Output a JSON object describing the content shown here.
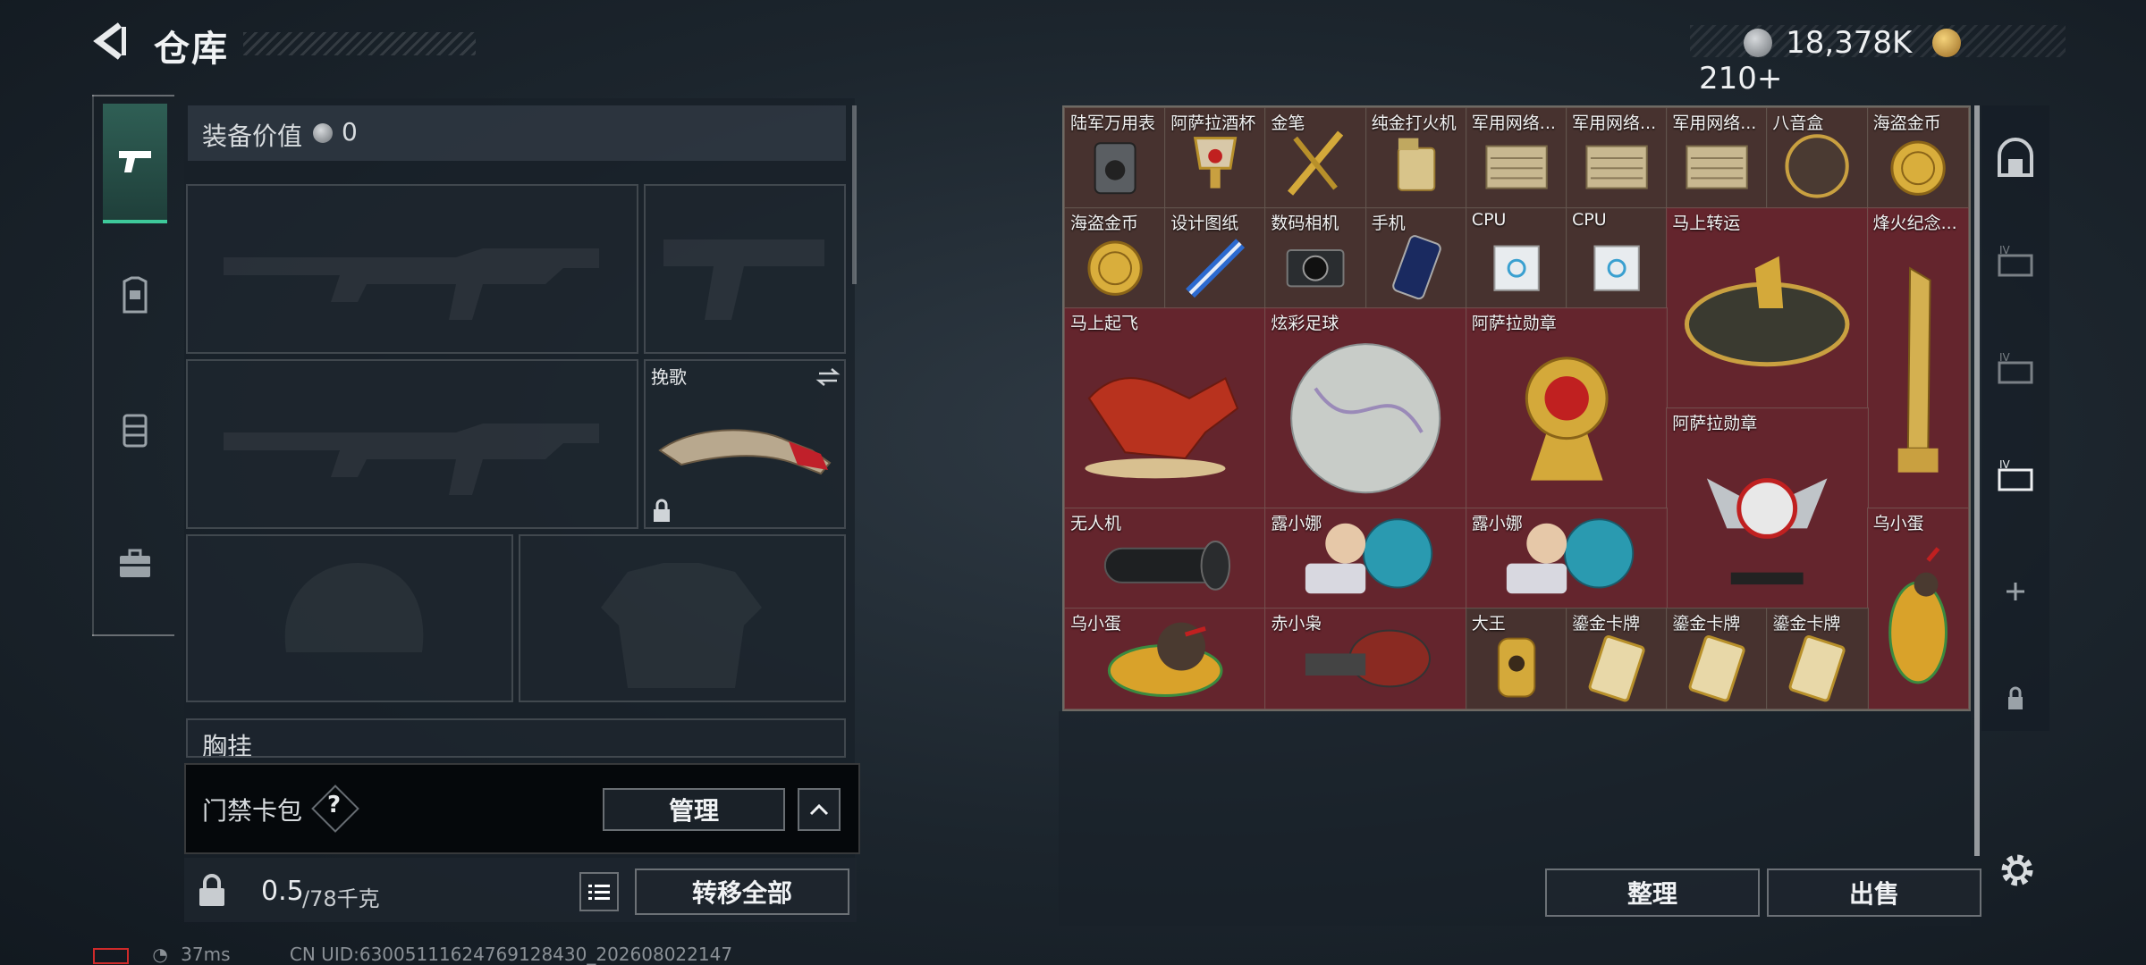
{
  "header": {
    "title": "仓库"
  },
  "currency": {
    "coins": "18,378K",
    "tokens": "210+"
  },
  "left": {
    "value_label": "装备价值",
    "value": "0",
    "melee_name": "挽歌",
    "chest_label": "胸挂",
    "keycard_label": "门禁卡包",
    "keycard_help": "?",
    "manage_label": "管理",
    "weight_value": "0.5",
    "weight_max": "/78千克",
    "transfer_all_label": "转移全部"
  },
  "grid": {
    "items": [
      {
        "name": "陆军万用表",
        "icon": "multimeter-icon"
      },
      {
        "name": "阿萨拉酒杯",
        "icon": "goblet-icon"
      },
      {
        "name": "金笔",
        "icon": "gold-pen-icon"
      },
      {
        "name": "纯金打火机",
        "icon": "lighter-icon"
      },
      {
        "name": "军用网络...",
        "icon": "network-module-icon"
      },
      {
        "name": "军用网络...",
        "icon": "network-module-icon"
      },
      {
        "name": "军用网络...",
        "icon": "network-module-icon"
      },
      {
        "name": "八音盒",
        "icon": "music-box-icon"
      },
      {
        "name": "海盗金币",
        "icon": "pirate-coin-icon"
      },
      {
        "name": "海盗金币",
        "icon": "pirate-coin-icon"
      },
      {
        "name": "设计图纸",
        "icon": "blueprint-icon"
      },
      {
        "name": "数码相机",
        "icon": "camera-icon"
      },
      {
        "name": "手机",
        "icon": "phone-icon"
      },
      {
        "name": "CPU",
        "icon": "cpu-icon"
      },
      {
        "name": "CPU",
        "icon": "cpu-icon"
      },
      {
        "name": "马上转运",
        "icon": "horse-disc-icon"
      },
      {
        "name": "烽火纪念...",
        "icon": "trophy-icon"
      },
      {
        "name": "马上起飞",
        "icon": "horse-statue-icon"
      },
      {
        "name": "炫彩足球",
        "icon": "iridescent-ball-icon"
      },
      {
        "name": "阿萨拉勋章",
        "icon": "medal-icon"
      },
      {
        "name": "阿萨拉勋章",
        "icon": "winged-medal-icon"
      },
      {
        "name": "无人机",
        "icon": "drone-icon"
      },
      {
        "name": "露小娜",
        "icon": "doll-icon"
      },
      {
        "name": "露小娜",
        "icon": "doll-icon"
      },
      {
        "name": "乌小蛋",
        "icon": "egg-figure-icon"
      },
      {
        "name": "乌小蛋",
        "icon": "egg-figure-icon"
      },
      {
        "name": "赤小枭",
        "icon": "owl-figure-icon"
      },
      {
        "name": "大王",
        "icon": "king-card-icon"
      },
      {
        "name": "鎏金卡牌",
        "icon": "gold-card-icon"
      },
      {
        "name": "鎏金卡牌",
        "icon": "gold-card-icon"
      },
      {
        "name": "鎏金卡牌",
        "icon": "gold-card-icon"
      }
    ]
  },
  "actions": {
    "sort_label": "整理",
    "sell_label": "出售"
  },
  "status": {
    "ping": "37ms",
    "uid": "CN UID:63005111624769128430_202608022147"
  },
  "colors": {
    "accent": "#3ec99a",
    "item_bg": "#4a3430",
    "big_item_bg": "#68242e"
  }
}
